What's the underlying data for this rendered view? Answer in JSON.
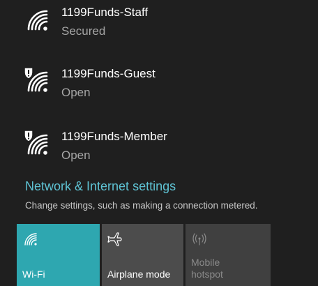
{
  "networks": [
    {
      "name": "1199Funds-Staff",
      "status": "Secured",
      "secure": true
    },
    {
      "name": "1199Funds-Guest",
      "status": "Open",
      "secure": false
    },
    {
      "name": "1199Funds-Member",
      "status": "Open",
      "secure": false
    }
  ],
  "settings": {
    "link": "Network & Internet settings",
    "description": "Change settings, such as making a connection metered."
  },
  "quick_actions": {
    "wifi": {
      "label": "Wi-Fi",
      "icon": "wifi-icon",
      "active": true
    },
    "airplane": {
      "label": "Airplane mode",
      "icon": "airplane-icon",
      "active": false
    },
    "hotspot": {
      "label_line1": "Mobile",
      "label_line2": "hotspot",
      "icon": "hotspot-icon",
      "active": false,
      "disabled": true
    }
  },
  "colors": {
    "background": "#1f1f1f",
    "accent": "#2ea7b0",
    "link": "#5fc3d4",
    "secondary_text": "#a6a6a6",
    "tile_inactive": "#4c4c4c",
    "tile_disabled": "#404040"
  }
}
